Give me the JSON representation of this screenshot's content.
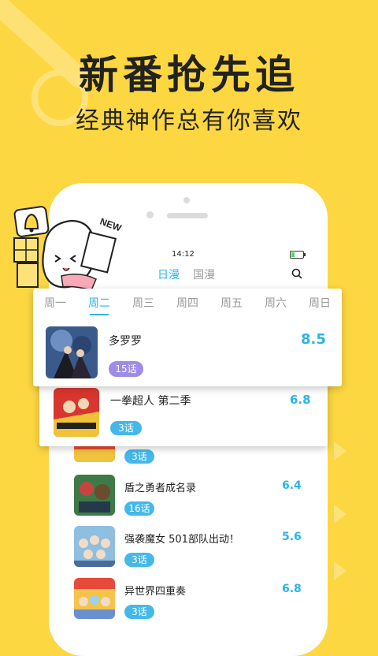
{
  "hero": {
    "headline": "新番抢先追",
    "subline": "经典神作总有你喜欢"
  },
  "status": {
    "time": "14:12",
    "battery_level": 0.3
  },
  "tabs": [
    {
      "label": "日漫",
      "active": true
    },
    {
      "label": "国漫",
      "active": false
    }
  ],
  "icons": {
    "search": "search-icon",
    "bell": "bell-icon"
  },
  "mascot": {
    "label": "NEW"
  },
  "weekdays": [
    {
      "label": "周一",
      "active": false
    },
    {
      "label": "周二",
      "active": true
    },
    {
      "label": "周三",
      "active": false
    },
    {
      "label": "周四",
      "active": false
    },
    {
      "label": "周五",
      "active": false
    },
    {
      "label": "周六",
      "active": false
    },
    {
      "label": "周日",
      "active": false
    }
  ],
  "featured": {
    "title": "多罗罗",
    "score": "8.5",
    "episodes": "15话"
  },
  "second": {
    "title": "一拳超人 第二季",
    "score": "6.8",
    "episodes": "3话"
  },
  "list": [
    {
      "title": "",
      "score": "",
      "episodes": "3话"
    },
    {
      "title": "盾之勇者成名录",
      "score": "6.4",
      "episodes": "16话"
    },
    {
      "title": "强袭魔女 501部队出动！",
      "score": "5.6",
      "episodes": "3话"
    },
    {
      "title": "异世界四重奏",
      "score": "6.8",
      "episodes": "3话"
    }
  ],
  "colors": {
    "background": "#fcd741",
    "accent": "#2ab4ea",
    "badge_purple": "#9e8ce8"
  }
}
